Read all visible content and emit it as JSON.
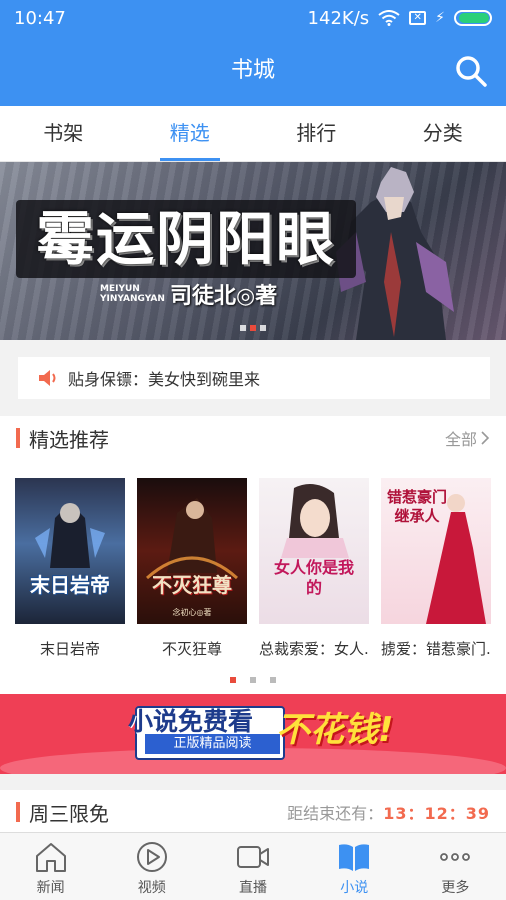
{
  "status_bar": {
    "time": "10:47",
    "speed": "142K/s"
  },
  "header": {
    "title": "书城"
  },
  "tabs": [
    {
      "label": "书架"
    },
    {
      "label": "精选"
    },
    {
      "label": "排行"
    },
    {
      "label": "分类"
    }
  ],
  "banner": {
    "title": "霉运阴阳眼",
    "pinyin_1": "MEIYUN",
    "pinyin_2": "YINYANGYAN",
    "author": "司徒北◎著",
    "slide_count": 3,
    "active_slide": 2
  },
  "notice": {
    "text": "贴身保镖：美女快到碗里来"
  },
  "featured": {
    "title": "精选推荐",
    "more": "全部",
    "books": [
      {
        "name": "末日岩帝",
        "cover_title": "末日岩帝"
      },
      {
        "name": "不灭狂尊",
        "cover_title": "不灭狂尊",
        "cover_author": "念初心◎著"
      },
      {
        "name": "总裁索爱：女人...",
        "cover_title": "女人你是我的"
      },
      {
        "name": "掳爱：错惹豪门...",
        "cover_title": "错惹豪门继承人"
      }
    ]
  },
  "promo": {
    "line1": "小说免费看",
    "line1b": "不花钱!",
    "line2": "正版精品阅读"
  },
  "limited": {
    "title": "周三限免",
    "countdown_label": "距结束还有：",
    "countdown": "13：12：39"
  },
  "bottom_nav": [
    {
      "label": "新闻"
    },
    {
      "label": "视频"
    },
    {
      "label": "直播"
    },
    {
      "label": "小说"
    },
    {
      "label": "更多"
    }
  ],
  "colors": {
    "primary": "#3d91f2",
    "accent": "#f26a4f",
    "promo": "#ef3f55"
  }
}
